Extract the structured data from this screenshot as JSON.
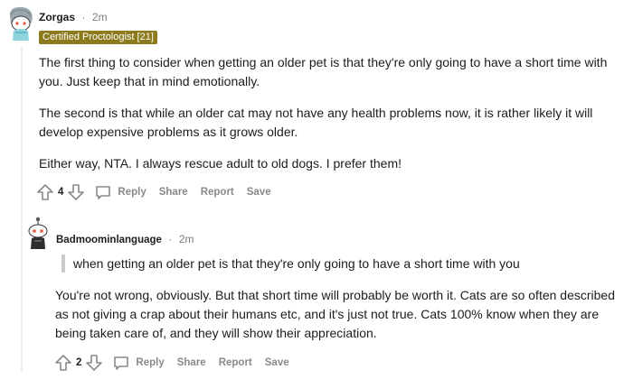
{
  "comments": [
    {
      "username": "Zorgas",
      "time": "2m",
      "flair": "Certified Proctologist [21]",
      "paragraphs": [
        "The first thing to consider when getting an older pet is that they're only going to have a short time with you. Just keep that in mind emotionally.",
        "The second is that while an older cat may not have any health problems now, it is rather likely it will develop expensive problems as it grows older.",
        "Either way, NTA. I always rescue adult to old dogs. I prefer them!"
      ],
      "score": "4",
      "actions": {
        "reply": "Reply",
        "share": "Share",
        "report": "Report",
        "save": "Save"
      }
    },
    {
      "username": "Badmoominlanguage",
      "time": "2m",
      "quote": "when getting an older pet is that they're only going to have a short time with you",
      "paragraphs": [
        "You're not wrong, obviously. But that short time will probably be worth it. Cats are so often described as not giving a crap about their humans etc, and it's just not true. Cats 100% know when they are being taken care of, and they will show their appreciation."
      ],
      "score": "2",
      "actions": {
        "reply": "Reply",
        "share": "Share",
        "report": "Report",
        "save": "Save"
      }
    }
  ],
  "meta_separator": "·",
  "colors": {
    "flair_bg": "#8c7a1c",
    "meta": "#7c7c7c",
    "action": "#878a8c",
    "quote_bar": "#c8cbcd"
  },
  "icons": [
    "upvote-icon",
    "downvote-icon",
    "comment-icon",
    "snoo-avatar"
  ]
}
